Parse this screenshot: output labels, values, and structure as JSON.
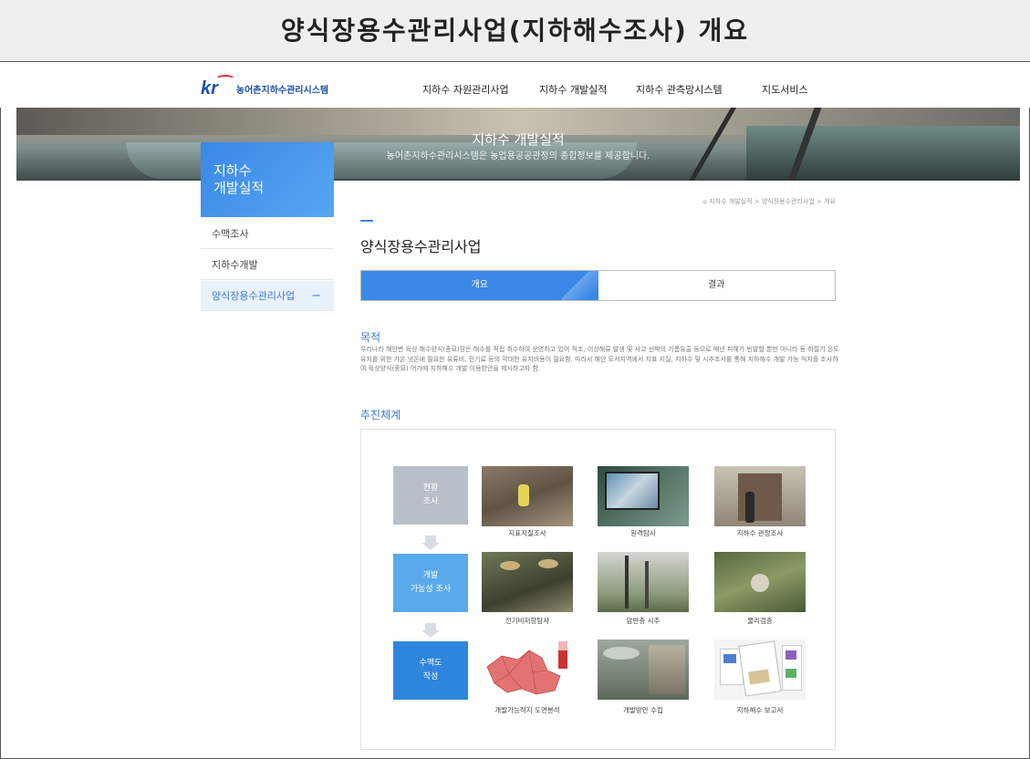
{
  "slide_title": "양식장용수관리사업(지하해수조사) 개요",
  "header": {
    "logo_mark": "kr",
    "logo_text": "농어촌지하수관리시스템",
    "menu": [
      "지하수 자원관리사업",
      "지하수 개발실적",
      "지하수 관측망시스템",
      "지도서비스"
    ]
  },
  "hero": {
    "title": "지하수 개발실적",
    "subtitle": "농어촌지하수관리시스템은 농업용공공관정의 종합정보를 제공합니다."
  },
  "sidebar": {
    "title": "지하수\n개발실적",
    "items": [
      {
        "label": "수맥조사",
        "active": false
      },
      {
        "label": "지하수개발",
        "active": false
      },
      {
        "label": "양식장용수관리사업",
        "active": true,
        "toggle": "−"
      }
    ]
  },
  "breadcrumb": "지하수 개발실적 > 양식장용수관리사업 > 개요",
  "page_heading": "양식장용수관리사업",
  "tabs": [
    {
      "label": "개요",
      "active": true
    },
    {
      "label": "결과",
      "active": false
    }
  ],
  "purpose": {
    "heading": "목적",
    "text": "우리나라 해안변 육상 해수양식(종묘)장은 해수를 직접 취수하여 운영하고 있어 적조, 이상해류 발생 및 사고 선박의 기름유출 등으로 매년 피해가 빈발할 뿐만 아니라 동·하절기 온도 유지를 위한 가온·냉온에 필요한 유류비, 전기료 등의 막대한 유지비용이 필요함. 따라서 해안 도서지역에서 지표 지질, 지하수 및 시추조사를 통해 지하해수 개발 가능 적지를 조사하여 육상양식(종묘) 어가에 지하해수 개발 이용방안을 제시하고자 함."
  },
  "process": {
    "heading": "추진체계",
    "stages": [
      {
        "label": "현황\n조사",
        "color": "#b8bfc9",
        "photos": [
          "지표지질조사",
          "원격탐사",
          "지하수 관정조사"
        ]
      },
      {
        "label": "개발\n가능성 조사",
        "color": "#5aa9ea",
        "photos": [
          "전기비저항탐사",
          "암반층 시추",
          "물리검층"
        ]
      },
      {
        "label": "수맥도\n작성",
        "color": "#2f86dd",
        "photos": [
          "개발가능적지 도면분석",
          "개발방안 수립",
          "지하해수 보고서"
        ]
      }
    ]
  },
  "colors": {
    "accent": "#3a88e6",
    "title_bg": "#efefef"
  }
}
